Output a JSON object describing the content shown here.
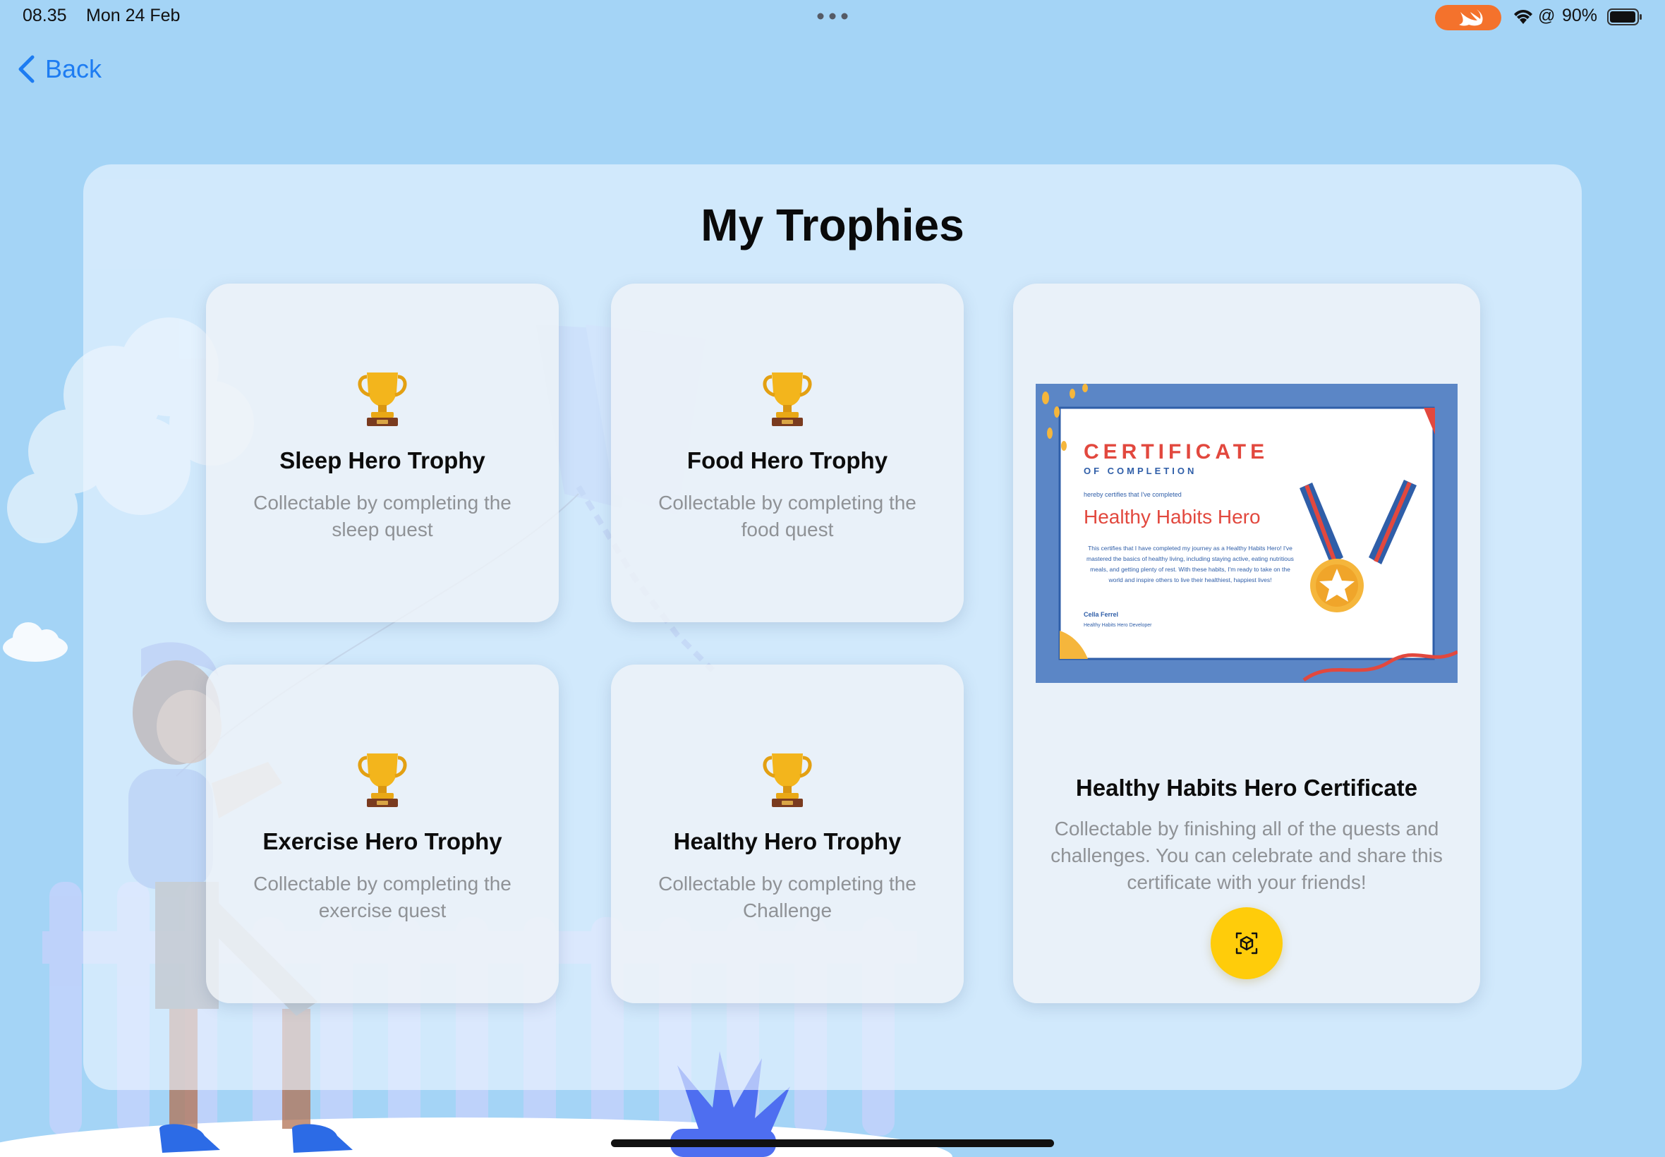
{
  "status_bar": {
    "time": "08.35",
    "date": "Mon 24 Feb",
    "battery_percent": "90%",
    "icons": [
      "swift-icon",
      "wifi-icon",
      "at-icon",
      "battery-icon"
    ]
  },
  "navigation": {
    "back_label": "Back"
  },
  "page": {
    "title": "My Trophies"
  },
  "trophies": [
    {
      "title": "Sleep Hero Trophy",
      "description": "Collectable by completing the sleep quest",
      "icon": "trophy-icon"
    },
    {
      "title": "Food Hero Trophy",
      "description": "Collectable by completing the food quest",
      "icon": "trophy-icon"
    },
    {
      "title": "Exercise Hero Trophy",
      "description": "Collectable by completing the exercise quest",
      "icon": "trophy-icon"
    },
    {
      "title": "Healthy Hero Trophy",
      "description": "Collectable by completing the Challenge",
      "icon": "trophy-icon"
    }
  ],
  "certificate": {
    "title": "Healthy Habits Hero Certificate",
    "description": "Collectable by finishing all of the quests and challenges. You can celebrate and share this certificate with your friends!",
    "ar_button_icon": "ar-view-icon",
    "image": {
      "heading": "CERTIFICATE",
      "subheading": "OF COMPLETION",
      "intro": "hereby certifies that I've completed",
      "name": "Healthy Habits Hero",
      "body": "This certifies that I have completed my journey as a Healthy Habits Hero! I've mastered the basics of healthy living, including staying active, eating nutritious meals, and getting plenty of rest. With these habits, I'm ready to take on the world and inspire others to live their healthiest, happiest lives!",
      "signer": "Cella Ferrel",
      "signer_role": "Healthy Habits Hero Developer"
    }
  },
  "colors": {
    "background": "#a4d4f6",
    "accent": "#1d7cf2",
    "ar_button": "#ffcc0a",
    "cert_border": "#5b86c6",
    "cert_red": "#e2483e"
  }
}
